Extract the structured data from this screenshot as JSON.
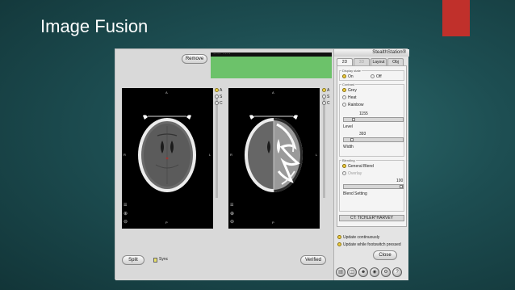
{
  "slide": {
    "title": "Image Fusion"
  },
  "toolbar": {
    "remove_label": "Remove",
    "top_readout": "---- ----",
    "split_label": "Split",
    "sync_label": "Sync",
    "verified_label": "Verified"
  },
  "views": {
    "controls": {
      "a": "A",
      "s": "S",
      "c": "C"
    },
    "orient": {
      "top": "A",
      "bottom": "P",
      "left": "R",
      "right": "L"
    }
  },
  "panel": {
    "brand": "StealthStation®",
    "tabs": [
      "2D",
      "3D",
      "Layout",
      "Obj"
    ],
    "display_state": {
      "title": "Display state",
      "on": "On",
      "off": "Off"
    },
    "contrast": {
      "title": "Contrast",
      "grey": "Grey",
      "heat": "Heat",
      "rainbow": "Rainbow"
    },
    "level": {
      "value": "1155",
      "label": "Level",
      "fraction": 0.15
    },
    "width": {
      "value": "393",
      "label": "Width",
      "fraction": 0.12
    },
    "blending": {
      "title": "Blending",
      "general": "General Blend",
      "overlay": "Overlay",
      "value": "100",
      "label": "Blend Setting",
      "fraction": 1.0
    },
    "patient": "CT: TICHLER^HARVEY",
    "update_continuously": "Update continuously",
    "update_footswitch": "Update while footswitch pressed",
    "close_label": "Close"
  },
  "colors": {
    "accent_red": "#c0302b",
    "green_bar": "#6cc26a",
    "selected_yellow": "#f0cc3c",
    "background": "#1d4e52"
  }
}
